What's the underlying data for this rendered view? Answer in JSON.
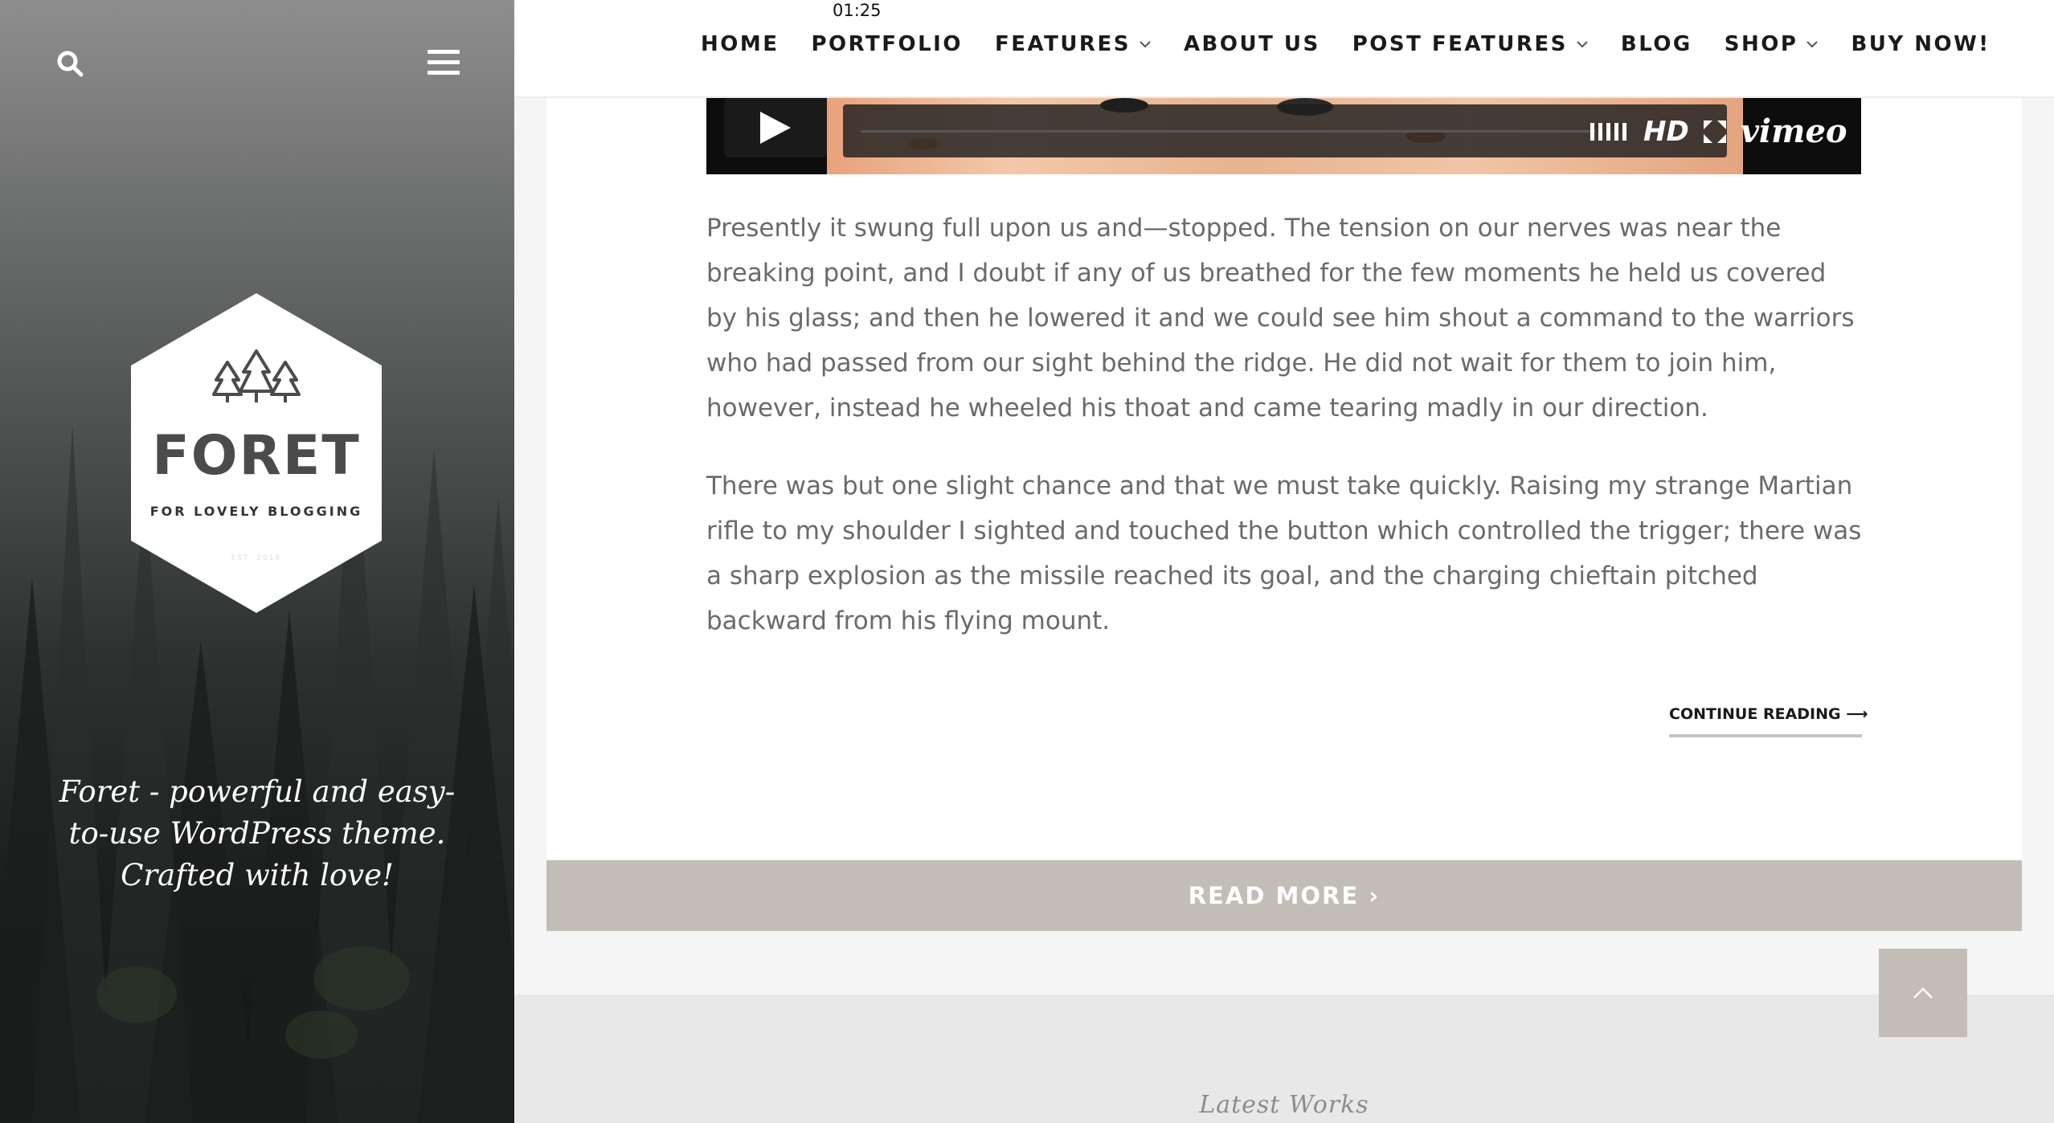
{
  "sidebar": {
    "logo": {
      "title": "FORET",
      "subtitle": "FOR LOVELY BLOGGING",
      "est": "EST. 2016"
    },
    "tagline": "Foret - powerful and easy-to-use WordPress theme. Crafted with love!",
    "icons": {
      "search": "search-icon",
      "menu": "hamburger-menu-icon"
    }
  },
  "nav": {
    "items": [
      {
        "label": "HOME",
        "dropdown": false
      },
      {
        "label": "PORTFOLIO",
        "dropdown": false
      },
      {
        "label": "FEATURES",
        "dropdown": true
      },
      {
        "label": "ABOUT US",
        "dropdown": false
      },
      {
        "label": "POST FEATURES",
        "dropdown": true
      },
      {
        "label": "BLOG",
        "dropdown": false
      },
      {
        "label": "SHOP",
        "dropdown": true
      },
      {
        "label": "BUY NOW!",
        "dropdown": false
      }
    ]
  },
  "video": {
    "time": "01:25",
    "hd_label": "HD",
    "brand": "vimeo",
    "progress": 0
  },
  "article": {
    "paragraphs": [
      "Presently it swung full upon us and—stopped. The tension on our nerves was near the breaking point, and I doubt if any of us breathed for the few moments he held us covered by his glass; and then he lowered it and we could see him shout a command to the warriors who had passed from our sight behind the ridge. He did not wait for them to join him, however, instead he wheeled his thoat and came tearing madly in our direction.",
      "There was but one slight chance and that we must take quickly. Raising my strange Martian rifle to my shoulder I sighted and touched the button which controlled the trigger; there was a sharp explosion as the missile reached its goal, and the charging chieftain pitched backward from his flying mount."
    ],
    "continue_label": "CONTINUE READING ⟶"
  },
  "read_more": {
    "label": "READ MORE ›"
  },
  "footer": {
    "section_title": "Latest Works"
  },
  "colors": {
    "accent": "#c2bdb6",
    "text": "#6a6a6a",
    "nav_text": "#1a1a1a",
    "sidebar_dark": "#1c1f1e"
  }
}
